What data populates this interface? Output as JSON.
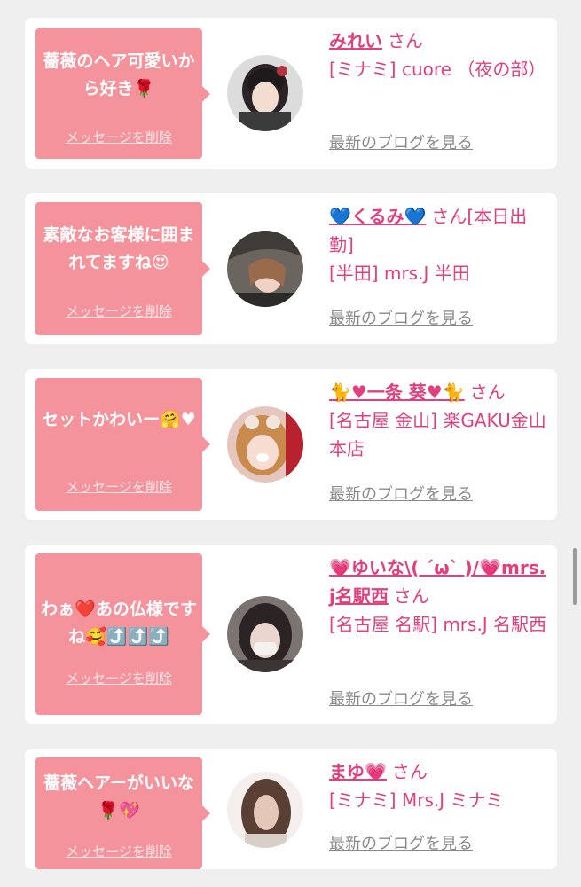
{
  "items": [
    {
      "message": "薔薇のヘア可愛いから好き🌹",
      "delete_label": "メッセージを削除",
      "name": "みれい",
      "honorific": "さん",
      "shop": "[ミナミ] cuore （夜の部）",
      "blog_label": "最新のブログを見る"
    },
    {
      "message": "素敵なお客様に囲まれてますね😍",
      "delete_label": "メッセージを削除",
      "name": "💙くるみ💙",
      "honorific": "さん[本日出勤]",
      "shop": "[半田] mrs.J 半田",
      "blog_label": "最新のブログを見る"
    },
    {
      "message": "セットかわいー🤗♥",
      "delete_label": "メッセージを削除",
      "name": "🐈♥一条 葵♥🐈",
      "honorific": "さん",
      "shop": "[名古屋 金山] 楽GAKU金山本店",
      "blog_label": "最新のブログを見る"
    },
    {
      "message": "わぁ❤️あの仏様ですね🥰⤴️⤴️⤴️",
      "delete_label": "メッセージを削除",
      "name": "💗ゆいな\\( ´ω` )/💗mrs.j名駅西",
      "honorific": "さん",
      "shop": "[名古屋 名駅] mrs.J 名駅西",
      "blog_label": "最新のブログを見る"
    },
    {
      "message": "薔薇ヘアーがいいな🌹💖",
      "delete_label": "メッセージを削除",
      "name": "まゆ💗",
      "honorific": "さん",
      "shop": "[ミナミ] Mrs.J ミナミ",
      "blog_label": "最新のブログを見る"
    }
  ],
  "colors": {
    "background": "#efefef",
    "card": "#ffffff",
    "bubble": "#f5939c",
    "accent_text": "#e0407e",
    "link_gray": "#8a8a8a"
  },
  "icons": [
    "avatar-photo",
    "speech-bubble-pointer"
  ]
}
